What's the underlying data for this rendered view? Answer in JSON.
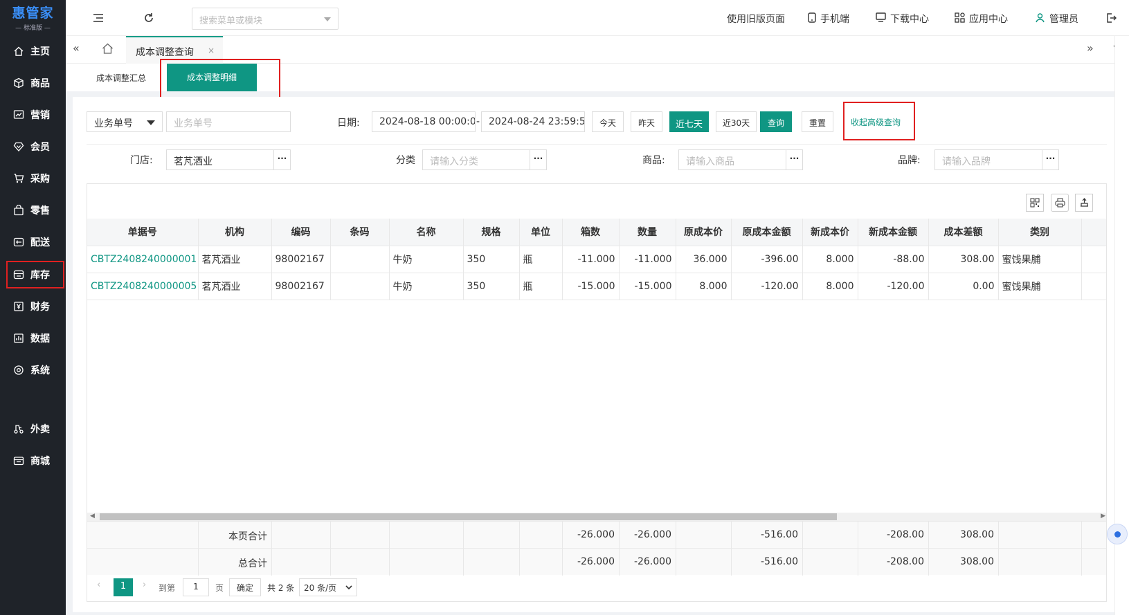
{
  "brand": {
    "name": "惠管家",
    "edition": "— 标准版 —"
  },
  "sidebar": {
    "items": [
      {
        "label": "主页",
        "icon": "home-icon"
      },
      {
        "label": "商品",
        "icon": "box-icon"
      },
      {
        "label": "营销",
        "icon": "chart-icon"
      },
      {
        "label": "会员",
        "icon": "diamond-icon"
      },
      {
        "label": "采购",
        "icon": "cart-icon"
      },
      {
        "label": "零售",
        "icon": "bag-icon"
      },
      {
        "label": "配送",
        "icon": "truck-icon"
      },
      {
        "label": "库存",
        "icon": "inventory-icon"
      },
      {
        "label": "财务",
        "icon": "yen-icon"
      },
      {
        "label": "数据",
        "icon": "data-icon"
      },
      {
        "label": "系统",
        "icon": "settings-icon"
      },
      {
        "label": "外卖",
        "icon": "delivery-icon"
      },
      {
        "label": "商城",
        "icon": "shop-icon"
      }
    ]
  },
  "topbar": {
    "search_placeholder": "搜索菜单或模块",
    "old_version": "使用旧版页面",
    "mobile": "手机端",
    "download": "下载中心",
    "apps": "应用中心",
    "user": "管理员"
  },
  "tabs": {
    "current": "成本调整查询",
    "close": "×"
  },
  "subtabs": {
    "summary": "成本调整汇总",
    "detail": "成本调整明细"
  },
  "filters": {
    "type_select": "业务单号",
    "order_placeholder": "业务单号",
    "date_label": "日期:",
    "date_start": "2024-08-18 00:00:00",
    "date_sep": "-",
    "date_end": "2024-08-24 23:59:59",
    "btn_today": "今天",
    "btn_yesterday": "昨天",
    "btn_7days": "近七天",
    "btn_30days": "近30天",
    "btn_query": "查询",
    "btn_reset": "重置",
    "btn_collapse": "收起高级查询",
    "store_label": "门店:",
    "store_value": "茗芃酒业",
    "category_label": "分类",
    "category_placeholder": "请输入分类",
    "product_label": "商品:",
    "product_placeholder": "请输入商品",
    "brand_label": "品牌:",
    "brand_placeholder": "请输入品牌",
    "dots": "···"
  },
  "table": {
    "columns": [
      "单据号",
      "机构",
      "编码",
      "条码",
      "名称",
      "规格",
      "单位",
      "箱数",
      "数量",
      "原成本价",
      "原成本金额",
      "新成本价",
      "新成本金额",
      "成本差额",
      "类别"
    ],
    "rows": [
      [
        "CBTZ2408240000001",
        "茗芃酒业",
        "98002167",
        "",
        "牛奶",
        "350",
        "瓶",
        "-11.000",
        "-11.000",
        "36.000",
        "-396.00",
        "8.000",
        "-88.00",
        "308.00",
        "蜜饯果脯"
      ],
      [
        "CBTZ2408240000005",
        "茗芃酒业",
        "98002167",
        "",
        "牛奶",
        "350",
        "瓶",
        "-15.000",
        "-15.000",
        "8.000",
        "-120.00",
        "8.000",
        "-120.00",
        "0.00",
        "蜜饯果脯"
      ]
    ],
    "page_total": {
      "label": "本页合计",
      "boxes": "-26.000",
      "qty": "-26.000",
      "old_amount": "-516.00",
      "new_amount": "-208.00",
      "diff": "308.00"
    },
    "grand_total": {
      "label": "总合计",
      "boxes": "-26.000",
      "qty": "-26.000",
      "old_amount": "-516.00",
      "new_amount": "-208.00",
      "diff": "308.00"
    }
  },
  "pager": {
    "current": "1",
    "goto_label": "到第",
    "goto_value": "1",
    "page_unit": "页",
    "confirm": "确定",
    "total": "共 2 条",
    "page_size": "20 条/页"
  },
  "colors": {
    "primary": "#0f9683",
    "sidebar": "#1f2329",
    "highlight": "#e02020"
  }
}
